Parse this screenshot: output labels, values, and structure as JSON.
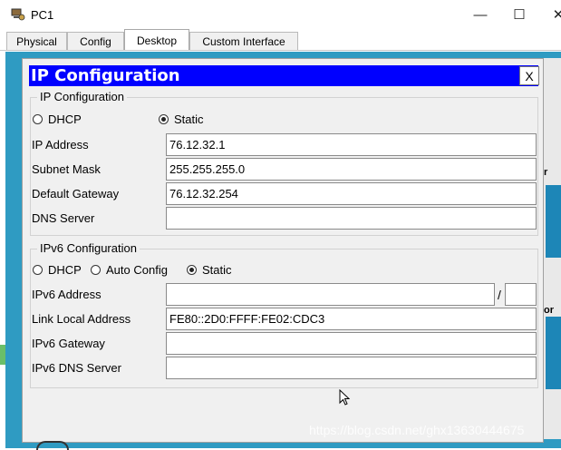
{
  "window": {
    "title": "PC1",
    "minimize_glyph": "—",
    "maximize_glyph": "☐",
    "close_glyph": "✕"
  },
  "tabs": [
    {
      "label": "Physical",
      "active": false
    },
    {
      "label": "Config",
      "active": false
    },
    {
      "label": "Desktop",
      "active": true
    },
    {
      "label": "Custom Interface",
      "active": false
    }
  ],
  "dialog": {
    "title": "IP Configuration",
    "close_label": "X",
    "ipv4": {
      "legend": "IP Configuration",
      "mode_dhcp": "DHCP",
      "mode_static": "Static",
      "selected_mode": "Static",
      "ip_label": "IP Address",
      "ip_value": "76.12.32.1",
      "mask_label": "Subnet Mask",
      "mask_value": "255.255.255.0",
      "gateway_label": "Default Gateway",
      "gateway_value": "76.12.32.254",
      "dns_label": "DNS Server",
      "dns_value": ""
    },
    "ipv6": {
      "legend": "IPv6 Configuration",
      "mode_dhcp": "DHCP",
      "mode_auto": "Auto Config",
      "mode_static": "Static",
      "selected_mode": "Static",
      "address_label": "IPv6 Address",
      "address_value": "",
      "prefix_separator": "/",
      "prefix_value": "",
      "link_local_label": "Link Local Address",
      "link_local_value": "FE80::2D0:FFFF:FE02:CDC3",
      "gateway_label": "IPv6 Gateway",
      "gateway_value": "",
      "dns_label": "IPv6 DNS Server",
      "dns_value": ""
    }
  },
  "background_fragments": {
    "fragment_1": "r",
    "fragment_2": "or"
  },
  "watermark": "https://blog.csdn.net/ghx13630444675",
  "colors": {
    "dialog_header": "#0000ff",
    "desktop_bg": "#2f9bc2",
    "dialog_bg": "#f0f0f0"
  },
  "icons": {
    "app": "packet-tracer-pc-icon",
    "cursor": "mouse-pointer-icon"
  }
}
